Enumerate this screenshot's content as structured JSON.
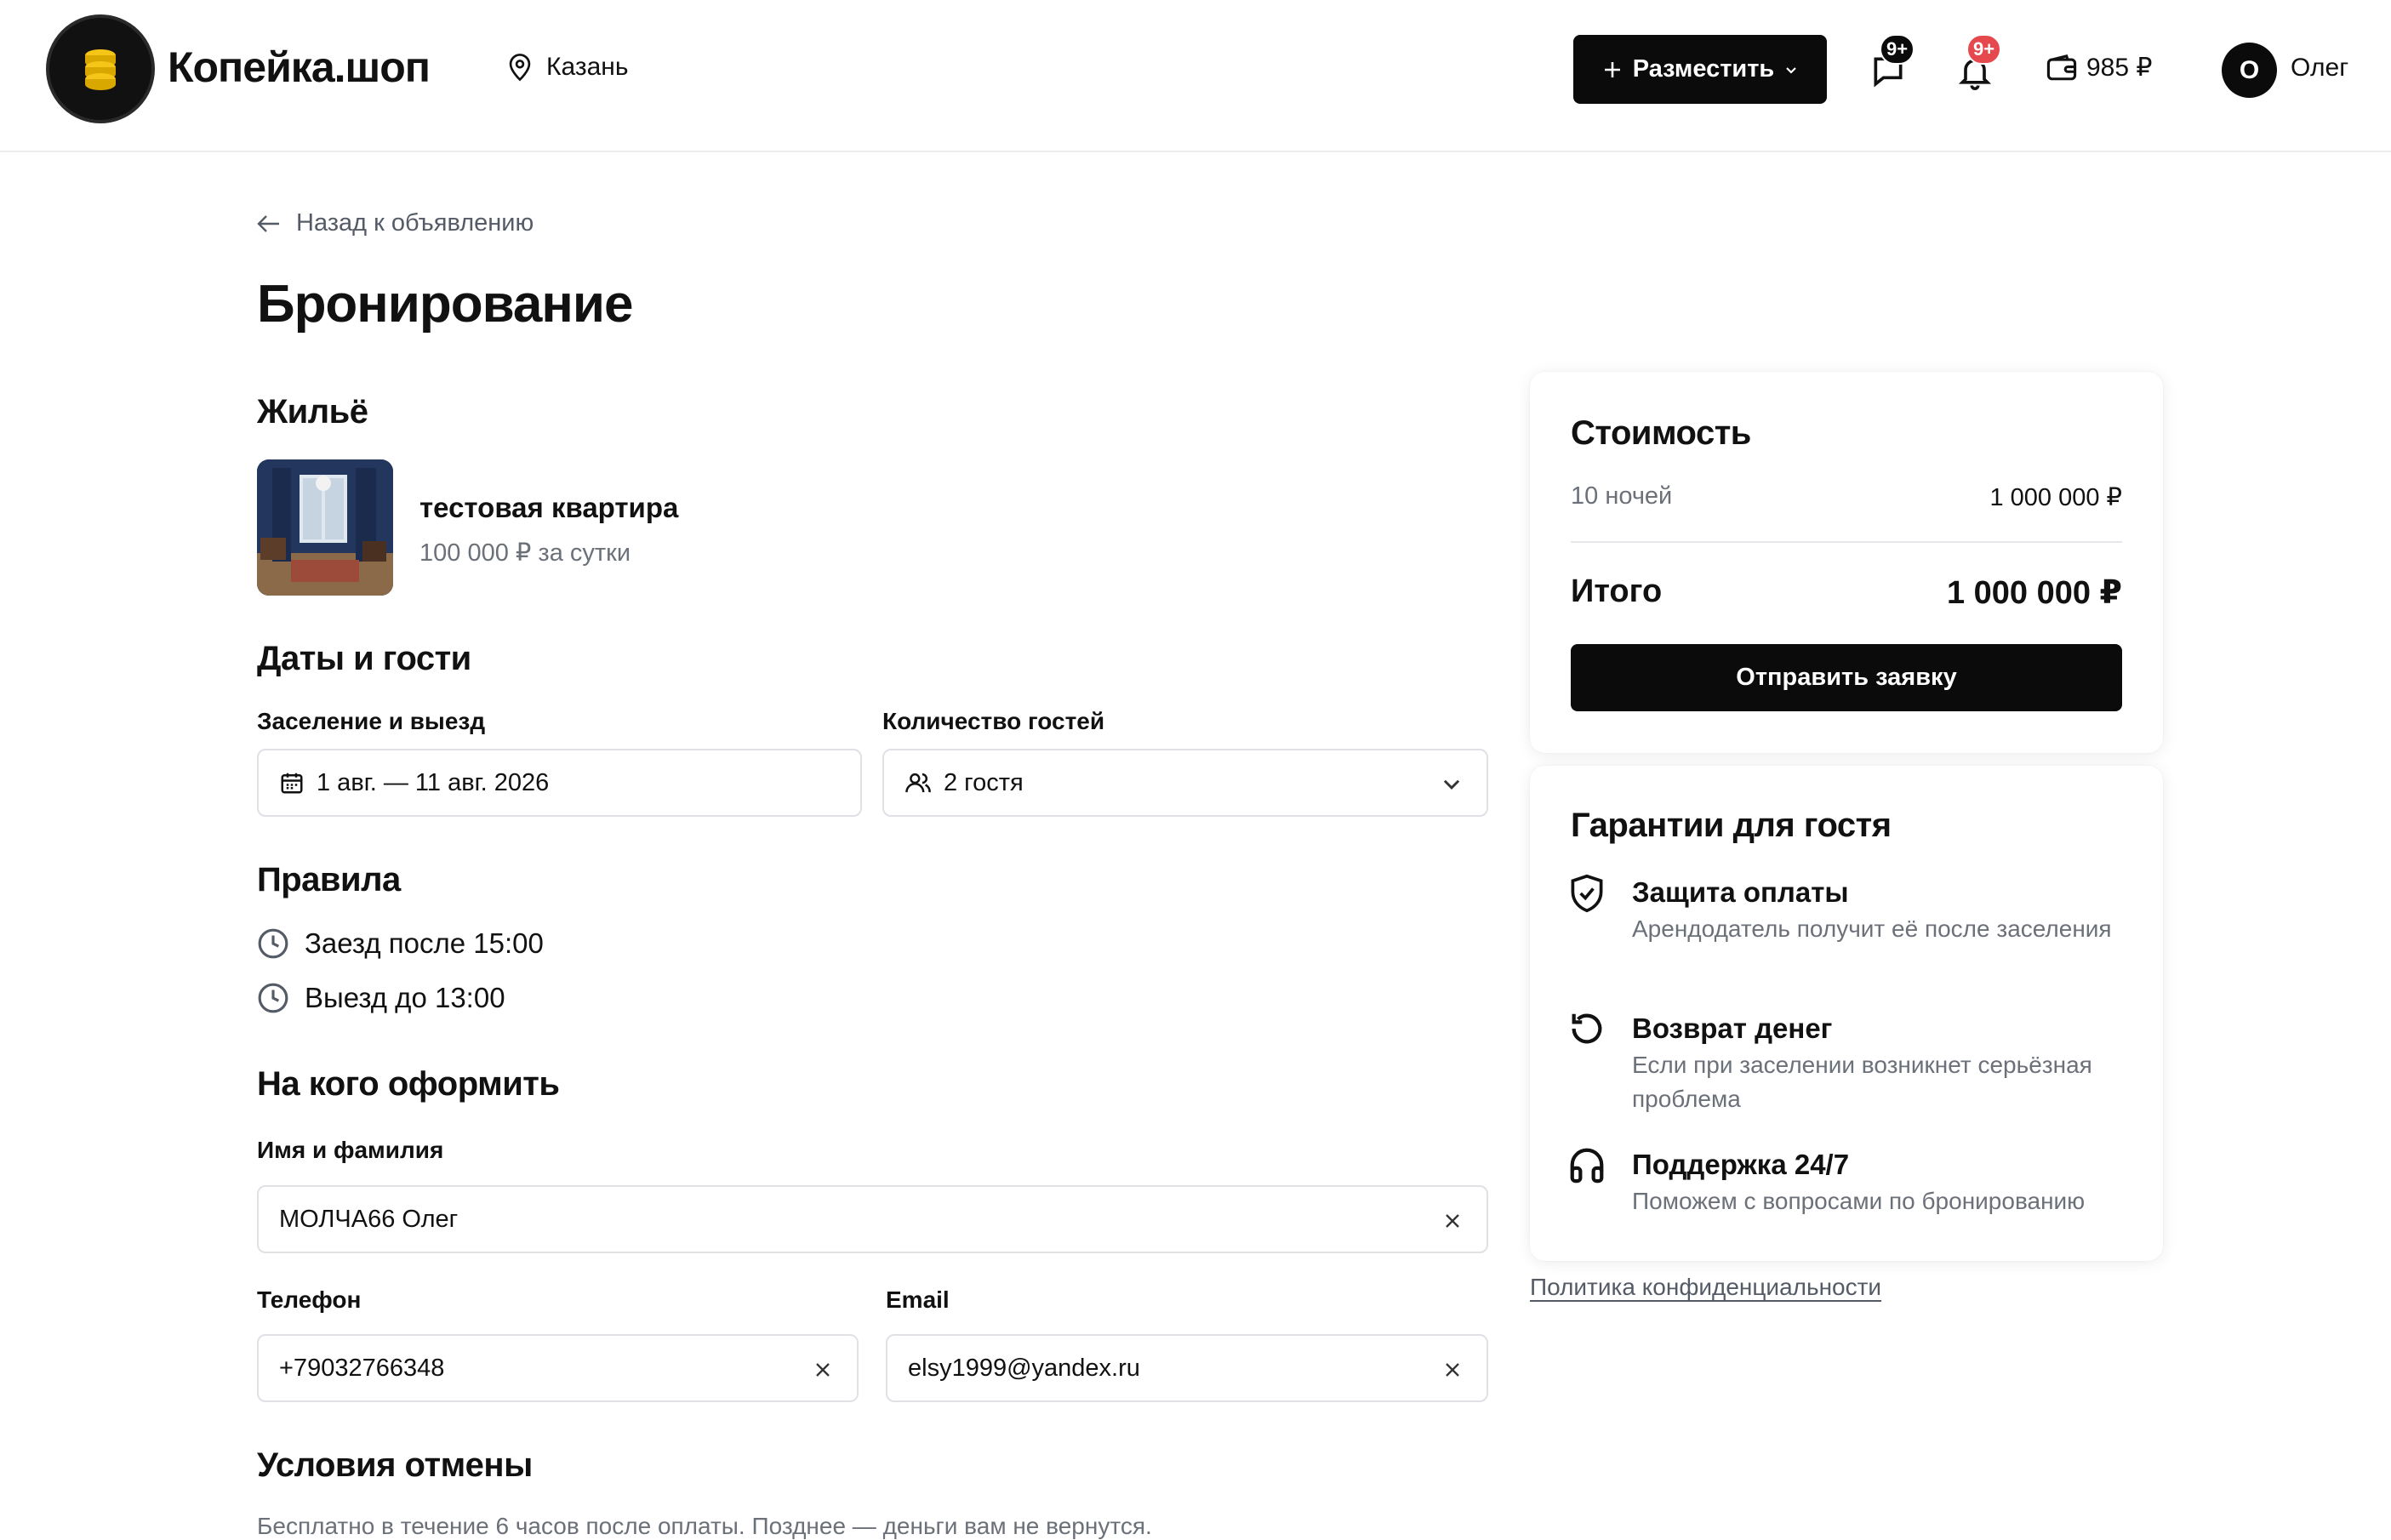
{
  "header": {
    "brand": "Копейка.шоп",
    "city": "Казань",
    "post_button": "Разместить",
    "messages_badge": "9+",
    "notifications_badge": "9+",
    "wallet_balance": "985 ₽",
    "user_initial": "О",
    "user_name": "Олег",
    "colors": {
      "accent": "#0b0b0b",
      "badge_red": "#e5484d",
      "logo_gold": "#f5c518"
    }
  },
  "page": {
    "back_link": "Назад к объявлению",
    "title": "Бронирование"
  },
  "listing": {
    "section_title": "Жильё",
    "title": "тестовая квартира",
    "price": "100 000 ₽ за сутки"
  },
  "dates_guests": {
    "section_title": "Даты и гости",
    "dates_label": "Заселение и выезд",
    "dates_value": "1 авг. — 11 авг. 2026",
    "guests_label": "Количество гостей",
    "guests_value": "2 гостя"
  },
  "rules": {
    "section_title": "Правила",
    "items": [
      "Заезд после 15:00",
      "Выезд до 13:00"
    ]
  },
  "booker": {
    "section_title": "На кого оформить",
    "name_label": "Имя и фамилия",
    "name_value": "МОЛЧА66 Олег",
    "phone_label": "Телефон",
    "phone_value": "+79032766348",
    "email_label": "Email",
    "email_value": "elsy1999@yandex.ru"
  },
  "cancellation": {
    "section_title": "Условия отмены",
    "text": "Бесплатно в течение 6 часов после оплаты. Позднее — деньги вам не вернутся."
  },
  "cost": {
    "title": "Стоимость",
    "nights_label": "10 ночей",
    "nights_amount": "1 000 000 ₽",
    "total_label": "Итого",
    "total_amount": "1 000 000 ₽",
    "submit_button": "Отправить заявку"
  },
  "guarantees": {
    "title": "Гарантии для гостя",
    "items": [
      {
        "icon": "shield-check-icon",
        "title": "Защита оплаты",
        "desc": "Арендодатель получит её после заселения"
      },
      {
        "icon": "refresh-icon",
        "title": "Возврат денег",
        "desc": "Если при заселении возникнет серьёзная проблема"
      },
      {
        "icon": "headphones-icon",
        "title": "Поддержка 24/7",
        "desc": "Поможем с вопросами по бронированию"
      }
    ]
  },
  "footer": {
    "privacy_link": "Политика конфиденциальности"
  }
}
